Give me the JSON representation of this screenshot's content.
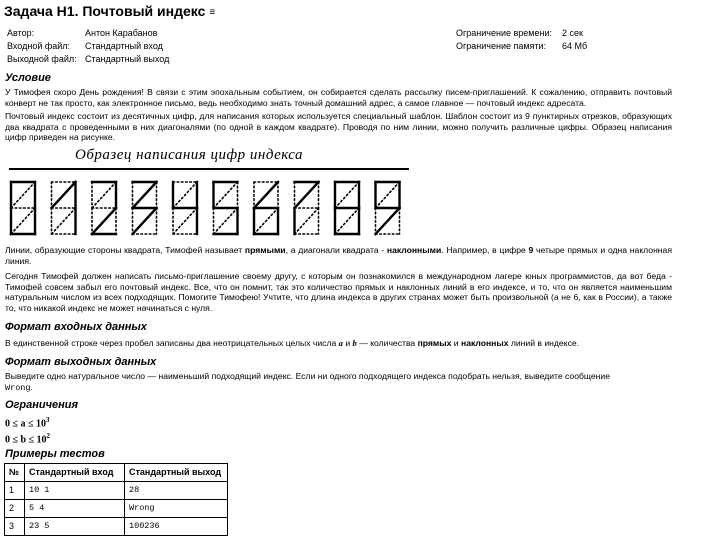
{
  "problem": {
    "title": "Задача H1. Почтовый индекс",
    "menu_icon": "≡"
  },
  "meta": {
    "author_label": "Автор:",
    "author_value": "Антон Карабанов",
    "input_label": "Входной файл:",
    "input_value": "Стандартный вход",
    "output_label": "Выходной файл:",
    "output_value": "Стандартный выход",
    "time_label": "Ограничение времени:",
    "time_value": "2 сек",
    "memory_label": "Ограничение памяти:",
    "memory_value": "64 Мб"
  },
  "statement": {
    "heading": "Условие",
    "p1": "У Тимофея скоро День рождения! В связи с этим эпохальным событием, он собирается сделать рассылку писем-приглашений. К сожалению, отправить почтовый конверт не так просто, как электронное письмо, ведь необходимо знать точный домашний адрес, а самое главное — почтовый индекс адресата.",
    "p2": "Почтовый индекс состоит из десятичных цифр, для написания которых используется специальный шаблон. Шаблон состоит из 9 пунктирных отрезков, образующих два квадрата с проведенными в них диагоналями (по одной в каждом квадрате). Проводя по ним линии, можно получить различные цифры. Образец написания цифр приведен на рисунке.",
    "figure_caption": "Образец написания цифр индекса",
    "p3_a": "Линии, образующие стороны квадрата, Тимофей называет ",
    "p3_b": "прямыми",
    "p3_c": ", а диагонали квадрата - ",
    "p3_d": "наклонными",
    "p3_e": ". Например, в цифре ",
    "p3_f": "9",
    "p3_g": " четыре прямых и одна наклонная линия.",
    "p4": "Сегодня Тимофей должен написать письмо-приглашение своему другу, с которым он познакомился в международном лагере юных программистов, да вот беда - Тимофей совсем забыл его почтовый индекс. Все, что он помнит, так это количество прямых и наклонных линий в его индексе, и то, что он является наименьшим натуральным числом из всех подходящих. Помогите Тимофею! Учтите, что длина индекса в других странах может быть произвольной (а не 6, как в России), а также то, что никакой индекс не может начинаться с нуля."
  },
  "input_format": {
    "heading": "Формат входных данных",
    "t1": "В единственной строке через пробел записаны два неотрицательных целых числа ",
    "a": "a",
    "t2": " и ",
    "b": "b",
    "t3": " — количества ",
    "t4": "прямых",
    "t5": " и ",
    "t6": "наклонных",
    "t7": " линий в индексе."
  },
  "output_format": {
    "heading": "Формат выходных данных",
    "t1": "Выведите одно натуральное число — наименьший подходящий индекс. Если ни одного подходящего индекса подобрать нельзя, выведите сообщение",
    "wrong": "Wrong",
    "t2": "."
  },
  "constraints": {
    "heading": "Ограничения",
    "line1": "0 ≤ a ≤ 10",
    "line1_exp": "3",
    "line2": "0 ≤ b ≤ 10",
    "line2_exp": "2"
  },
  "examples": {
    "heading": "Примеры тестов",
    "headers": [
      "№",
      "Стандартный вход",
      "Стандартный выход"
    ],
    "rows": [
      [
        "1",
        "10 1",
        "28"
      ],
      [
        "2",
        "5 4",
        "Wrong"
      ],
      [
        "3",
        "23 5",
        "100236"
      ]
    ]
  }
}
